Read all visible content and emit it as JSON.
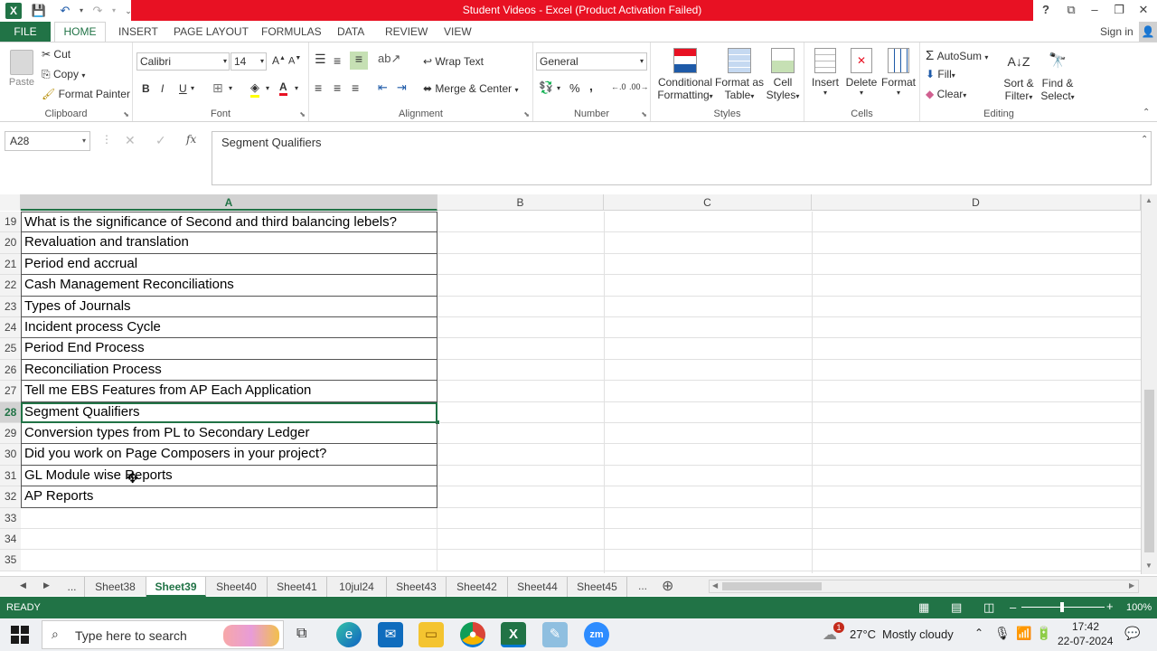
{
  "titlebar": {
    "title": "Student Videos -  Excel (Product Activation Failed)",
    "help": "?",
    "minimize": "–",
    "maximize": "❐",
    "close": "✕"
  },
  "tabs": {
    "file": "FILE",
    "home": "HOME",
    "insert": "INSERT",
    "page_layout": "PAGE LAYOUT",
    "formulas": "FORMULAS",
    "data": "DATA",
    "review": "REVIEW",
    "view": "VIEW",
    "signin": "Sign in"
  },
  "ribbon": {
    "clipboard": {
      "label": "Clipboard",
      "paste": "Paste",
      "cut": "Cut",
      "copy": "Copy",
      "format_painter": "Format Painter"
    },
    "font": {
      "label": "Font",
      "name": "Calibri",
      "size": "14",
      "bold": "B",
      "italic": "I",
      "underline": "U"
    },
    "alignment": {
      "label": "Alignment",
      "wrap": "Wrap Text",
      "merge": "Merge & Center"
    },
    "number": {
      "label": "Number",
      "format": "General",
      "percent": "%",
      "comma": ","
    },
    "styles": {
      "label": "Styles",
      "conditional": "Conditional",
      "conditional2": "Formatting",
      "format_as": "Format as",
      "format_as2": "Table",
      "cell": "Cell",
      "cell2": "Styles"
    },
    "cells": {
      "label": "Cells",
      "insert": "Insert",
      "delete": "Delete",
      "format": "Format"
    },
    "editing": {
      "label": "Editing",
      "autosum": "AutoSum",
      "fill": "Fill",
      "clear": "Clear",
      "sort": "Sort &",
      "sort2": "Filter",
      "find": "Find &",
      "find2": "Select"
    }
  },
  "formula_bar": {
    "name_box": "A28",
    "fx": "fx",
    "content": "Segment Qualifiers"
  },
  "columns": [
    "A",
    "B",
    "C",
    "D"
  ],
  "rows": [
    {
      "num": "19",
      "a": "What is the significance of Second and third balancing lebels?"
    },
    {
      "num": "20",
      "a": "Revaluation and translation"
    },
    {
      "num": "21",
      "a": "Period end accrual"
    },
    {
      "num": "22",
      "a": "Cash Management Reconciliations"
    },
    {
      "num": "23",
      "a": "Types of Journals"
    },
    {
      "num": "24",
      "a": "Incident process Cycle"
    },
    {
      "num": "25",
      "a": "Period End Process"
    },
    {
      "num": "26",
      "a": "Reconciliation Process"
    },
    {
      "num": "27",
      "a": "Tell me EBS Features from AP Each Application"
    },
    {
      "num": "28",
      "a": "Segment Qualifiers"
    },
    {
      "num": "29",
      "a": "Conversion types from PL to Secondary Ledger"
    },
    {
      "num": "30",
      "a": "Did you work on Page Composers in your project?"
    },
    {
      "num": "31",
      "a": "GL Module wise Reports"
    },
    {
      "num": "32",
      "a": "AP Reports"
    },
    {
      "num": "33",
      "a": ""
    },
    {
      "num": "34",
      "a": ""
    },
    {
      "num": "35",
      "a": ""
    }
  ],
  "sheets": {
    "ellipsis": "...",
    "tabs": [
      "Sheet38",
      "Sheet39",
      "Sheet40",
      "Sheet41",
      "10jul24",
      "Sheet43",
      "Sheet42",
      "Sheet44",
      "Sheet45"
    ],
    "active": "Sheet39",
    "more": "...",
    "add": "⊕"
  },
  "status": {
    "ready": "READY",
    "zoom": "100%",
    "minus": "–",
    "plus": "+"
  },
  "taskbar": {
    "search": "Type here to search",
    "weather": "27°C",
    "weather_text": "Mostly cloudy",
    "time": "17:42",
    "date": "22-07-2024",
    "badge": "1"
  },
  "colors": {
    "excel_green": "#217346",
    "title_red": "#e81123"
  }
}
